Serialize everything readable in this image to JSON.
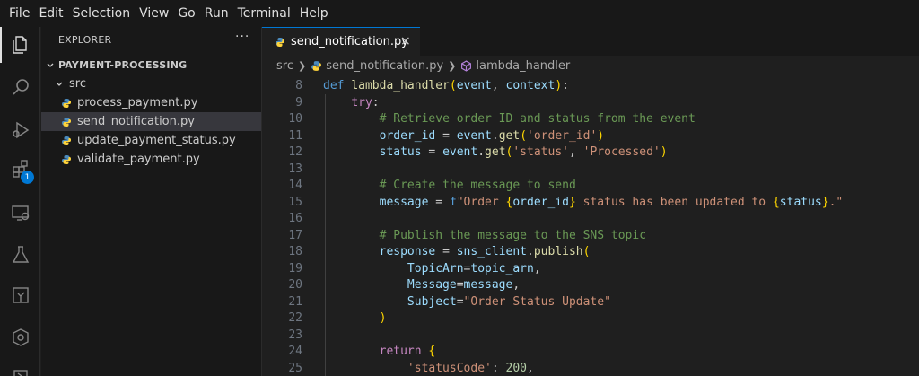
{
  "menubar": {
    "items": [
      "File",
      "Edit",
      "Selection",
      "View",
      "Go",
      "Run",
      "Terminal",
      "Help"
    ]
  },
  "activitybar": {
    "icons": [
      "files-icon",
      "search-icon",
      "run-debug-icon",
      "extensions-icon",
      "remote-explorer-icon",
      "testing-icon",
      "aws-toolkit-icon",
      "kubernetes-icon",
      "more-icon"
    ],
    "extensions_badge": "1",
    "accent": "#0078d4"
  },
  "sidebar": {
    "title": "EXPLORER",
    "more": "···",
    "project": "PAYMENT-PROCESSING",
    "folder": "src",
    "files": [
      "process_payment.py",
      "send_notification.py",
      "update_payment_status.py",
      "validate_payment.py"
    ],
    "selected_file": "send_notification.py"
  },
  "editor": {
    "tab_label": "send_notification.py",
    "tab_close": "×",
    "breadcrumb": {
      "folder": "src",
      "file": "send_notification.py",
      "symbol": "lambda_handler"
    },
    "lines": [
      {
        "n": "8",
        "tokens": [
          [
            "kw",
            "def "
          ],
          [
            "fn",
            "lambda_handler"
          ],
          [
            "br1",
            "("
          ],
          [
            "var",
            "event"
          ],
          [
            "",
            ","
          ],
          [
            "var",
            " context"
          ],
          [
            "br1",
            ")"
          ],
          [
            "",
            ":"
          ]
        ]
      },
      {
        "n": "9",
        "tokens": [
          [
            "",
            "    "
          ],
          [
            "kwc",
            "try"
          ],
          [
            "",
            ":"
          ]
        ]
      },
      {
        "n": "10",
        "tokens": [
          [
            "",
            "        "
          ],
          [
            "cmt",
            "# Retrieve order ID and status from the event"
          ]
        ]
      },
      {
        "n": "11",
        "tokens": [
          [
            "",
            "        "
          ],
          [
            "var",
            "order_id"
          ],
          [
            "",
            " = "
          ],
          [
            "var",
            "event"
          ],
          [
            "",
            "."
          ],
          [
            "fn",
            "get"
          ],
          [
            "br1",
            "("
          ],
          [
            "str",
            "'order_id'"
          ],
          [
            "br1",
            ")"
          ]
        ]
      },
      {
        "n": "12",
        "tokens": [
          [
            "",
            "        "
          ],
          [
            "var",
            "status"
          ],
          [
            "",
            " = "
          ],
          [
            "var",
            "event"
          ],
          [
            "",
            "."
          ],
          [
            "fn",
            "get"
          ],
          [
            "br1",
            "("
          ],
          [
            "str",
            "'status'"
          ],
          [
            "",
            ", "
          ],
          [
            "str",
            "'Processed'"
          ],
          [
            "br1",
            ")"
          ]
        ]
      },
      {
        "n": "13",
        "tokens": []
      },
      {
        "n": "14",
        "tokens": [
          [
            "",
            "        "
          ],
          [
            "cmt",
            "# Create the message to send"
          ]
        ]
      },
      {
        "n": "15",
        "tokens": [
          [
            "",
            "        "
          ],
          [
            "var",
            "message"
          ],
          [
            "",
            " = "
          ],
          [
            "kw",
            "f"
          ],
          [
            "str",
            "\"Order "
          ],
          [
            "br1",
            "{"
          ],
          [
            "var",
            "order_id"
          ],
          [
            "br1",
            "}"
          ],
          [
            "str",
            " status has been updated to "
          ],
          [
            "br1",
            "{"
          ],
          [
            "var",
            "status"
          ],
          [
            "br1",
            "}"
          ],
          [
            "str",
            ".\""
          ]
        ]
      },
      {
        "n": "16",
        "tokens": []
      },
      {
        "n": "17",
        "tokens": [
          [
            "",
            "        "
          ],
          [
            "cmt",
            "# Publish the message to the SNS topic"
          ]
        ]
      },
      {
        "n": "18",
        "tokens": [
          [
            "",
            "        "
          ],
          [
            "var",
            "response"
          ],
          [
            "",
            " = "
          ],
          [
            "var",
            "sns_client"
          ],
          [
            "",
            "."
          ],
          [
            "fn",
            "publish"
          ],
          [
            "br1",
            "("
          ]
        ]
      },
      {
        "n": "19",
        "tokens": [
          [
            "",
            "            "
          ],
          [
            "var",
            "TopicArn"
          ],
          [
            "",
            "="
          ],
          [
            "var",
            "topic_arn"
          ],
          [
            "",
            ","
          ]
        ]
      },
      {
        "n": "20",
        "tokens": [
          [
            "",
            "            "
          ],
          [
            "var",
            "Message"
          ],
          [
            "",
            "="
          ],
          [
            "var",
            "message"
          ],
          [
            "",
            ","
          ]
        ]
      },
      {
        "n": "21",
        "tokens": [
          [
            "",
            "            "
          ],
          [
            "var",
            "Subject"
          ],
          [
            "",
            "="
          ],
          [
            "str",
            "\"Order Status Update\""
          ]
        ]
      },
      {
        "n": "22",
        "tokens": [
          [
            "",
            "        "
          ],
          [
            "br1",
            ")"
          ]
        ]
      },
      {
        "n": "23",
        "tokens": []
      },
      {
        "n": "24",
        "tokens": [
          [
            "",
            "        "
          ],
          [
            "kwc",
            "return"
          ],
          [
            "",
            " "
          ],
          [
            "br1",
            "{"
          ]
        ]
      },
      {
        "n": "25",
        "tokens": [
          [
            "",
            "            "
          ],
          [
            "str",
            "'statusCode'"
          ],
          [
            "",
            ": "
          ],
          [
            "num",
            "200"
          ],
          [
            "",
            ","
          ]
        ]
      }
    ]
  }
}
